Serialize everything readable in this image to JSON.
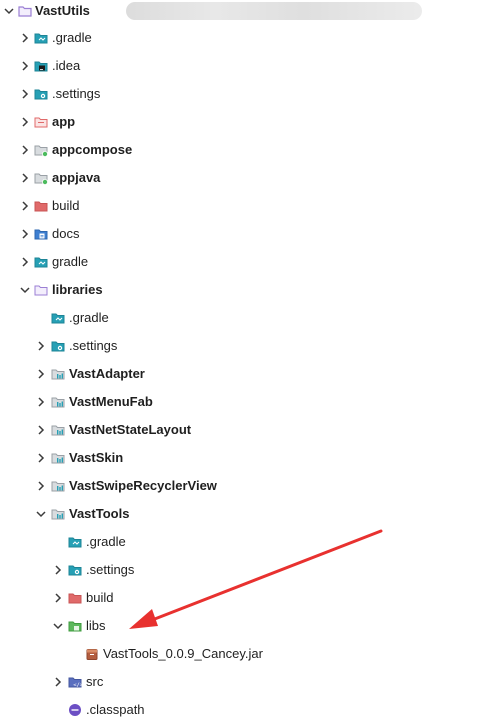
{
  "project": {
    "root_label": "VastUtils",
    "root_expanded": true
  },
  "tree": [
    {
      "id": "gradle-hidden",
      "label": ".gradle",
      "icon": "folder-teal-icon",
      "expandable": true,
      "expanded": false,
      "bold": false,
      "depth": 1
    },
    {
      "id": "idea",
      "label": ".idea",
      "icon": "folder-idea-icon",
      "expandable": true,
      "expanded": false,
      "bold": false,
      "depth": 1
    },
    {
      "id": "settings",
      "label": ".settings",
      "icon": "folder-settings-icon",
      "expandable": true,
      "expanded": false,
      "bold": false,
      "depth": 1
    },
    {
      "id": "app",
      "label": "app",
      "icon": "folder-red-module-icon",
      "expandable": true,
      "expanded": false,
      "bold": true,
      "depth": 1
    },
    {
      "id": "appcompose",
      "label": "appcompose",
      "icon": "folder-module-green-dot-icon",
      "expandable": true,
      "expanded": false,
      "bold": true,
      "depth": 1
    },
    {
      "id": "appjava",
      "label": "appjava",
      "icon": "folder-module-green-dot-icon",
      "expandable": true,
      "expanded": false,
      "bold": true,
      "depth": 1
    },
    {
      "id": "build",
      "label": "build",
      "icon": "folder-red-icon",
      "expandable": true,
      "expanded": false,
      "bold": false,
      "depth": 1
    },
    {
      "id": "docs",
      "label": "docs",
      "icon": "folder-docs-icon",
      "expandable": true,
      "expanded": false,
      "bold": false,
      "depth": 1
    },
    {
      "id": "gradle",
      "label": "gradle",
      "icon": "folder-teal-icon",
      "expandable": true,
      "expanded": false,
      "bold": false,
      "depth": 1
    },
    {
      "id": "libraries",
      "label": "libraries",
      "icon": "folder-purple-outline-icon",
      "expandable": true,
      "expanded": true,
      "bold": true,
      "depth": 1
    },
    {
      "id": "lib-gradle",
      "label": ".gradle",
      "icon": "folder-teal-icon",
      "expandable": false,
      "expanded": false,
      "bold": false,
      "depth": 2
    },
    {
      "id": "lib-settings",
      "label": ".settings",
      "icon": "folder-settings-icon",
      "expandable": true,
      "expanded": false,
      "bold": false,
      "depth": 2
    },
    {
      "id": "vastadapter",
      "label": "VastAdapter",
      "icon": "folder-module-icon",
      "expandable": true,
      "expanded": false,
      "bold": true,
      "depth": 2
    },
    {
      "id": "vastmenufab",
      "label": "VastMenuFab",
      "icon": "folder-module-icon",
      "expandable": true,
      "expanded": false,
      "bold": true,
      "depth": 2
    },
    {
      "id": "vastnetstatelayout",
      "label": "VastNetStateLayout",
      "icon": "folder-module-icon",
      "expandable": true,
      "expanded": false,
      "bold": true,
      "depth": 2
    },
    {
      "id": "vastskin",
      "label": "VastSkin",
      "icon": "folder-module-icon",
      "expandable": true,
      "expanded": false,
      "bold": true,
      "depth": 2
    },
    {
      "id": "vastswiperecyclerview",
      "label": "VastSwipeRecyclerView",
      "icon": "folder-module-icon",
      "expandable": true,
      "expanded": false,
      "bold": true,
      "depth": 2
    },
    {
      "id": "vasttools",
      "label": "VastTools",
      "icon": "folder-module-icon",
      "expandable": true,
      "expanded": true,
      "bold": true,
      "depth": 2
    },
    {
      "id": "vt-gradle",
      "label": ".gradle",
      "icon": "folder-teal-icon",
      "expandable": false,
      "expanded": false,
      "bold": false,
      "depth": 3
    },
    {
      "id": "vt-settings",
      "label": ".settings",
      "icon": "folder-settings-icon",
      "expandable": true,
      "expanded": false,
      "bold": false,
      "depth": 3
    },
    {
      "id": "vt-build",
      "label": "build",
      "icon": "folder-red-icon",
      "expandable": true,
      "expanded": false,
      "bold": false,
      "depth": 3
    },
    {
      "id": "vt-libs",
      "label": "libs",
      "icon": "folder-libs-green-icon",
      "expandable": true,
      "expanded": true,
      "bold": false,
      "depth": 3
    },
    {
      "id": "vt-jar",
      "label": "VastTools_0.0.9_Cancey.jar",
      "icon": "jar-file-icon",
      "expandable": false,
      "expanded": false,
      "bold": false,
      "depth": 4
    },
    {
      "id": "vt-src",
      "label": "src",
      "icon": "folder-src-icon",
      "expandable": true,
      "expanded": false,
      "bold": false,
      "depth": 3
    },
    {
      "id": "vt-classpath",
      "label": ".classpath",
      "icon": "classpath-file-icon",
      "expandable": false,
      "expanded": false,
      "bold": false,
      "depth": 3
    }
  ],
  "colors": {
    "annotation_arrow": "#e8312f",
    "chevron": "#3c3c3c",
    "folder_teal": "#26a0b5",
    "folder_red": "#e06a6a",
    "folder_purple": "#9b7fd4",
    "folder_gray": "#9aa0a6",
    "dot_green": "#4cbb5e"
  }
}
